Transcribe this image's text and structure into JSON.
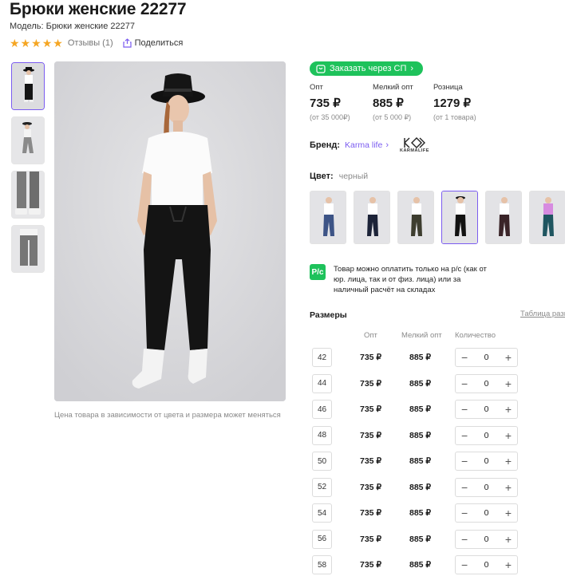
{
  "product": {
    "title": "Брюки женские 22277",
    "model": "Модель: Брюки женские 22277",
    "rating_stars": 5,
    "reviews_label": "Отзывы (1)",
    "share_label": "Поделиться"
  },
  "gallery": {
    "photo_note": "Цена товара в зависимости от цвета и размера может меняться"
  },
  "order": {
    "button_label": "Заказать через СП"
  },
  "prices": [
    {
      "label": "Опт",
      "value": "735 ₽",
      "sub": "(от 35 000₽)"
    },
    {
      "label": "Мелкий опт",
      "value": "885 ₽",
      "sub": "(от 5 000 ₽)"
    },
    {
      "label": "Розница",
      "value": "1279 ₽",
      "sub": "(от 1 товара)"
    }
  ],
  "brand": {
    "label": "Бренд:",
    "name": "Karma life",
    "logo_text": "KARMALIFE"
  },
  "color": {
    "label": "Цвет:",
    "value": "черный",
    "swatches": [
      "blue",
      "navy",
      "olive",
      "black",
      "brown",
      "teal"
    ]
  },
  "payment": {
    "icon_text": "P/c",
    "note": "Товар можно оплатить только на р/с (как от юр. лица, так и от физ. лица) или за наличный расчёт на складах"
  },
  "sizes": {
    "title": "Размеры",
    "table_link": "Таблица разм",
    "headers": {
      "opt": "Опт",
      "small": "Мелкий опт",
      "qty": "Количество"
    },
    "rows": [
      {
        "size": "42",
        "opt": "735 ₽",
        "small": "885 ₽",
        "qty": "0"
      },
      {
        "size": "44",
        "opt": "735 ₽",
        "small": "885 ₽",
        "qty": "0"
      },
      {
        "size": "46",
        "opt": "735 ₽",
        "small": "885 ₽",
        "qty": "0"
      },
      {
        "size": "48",
        "opt": "735 ₽",
        "small": "885 ₽",
        "qty": "0"
      },
      {
        "size": "50",
        "opt": "735 ₽",
        "small": "885 ₽",
        "qty": "0"
      },
      {
        "size": "52",
        "opt": "735 ₽",
        "small": "885 ₽",
        "qty": "0"
      },
      {
        "size": "54",
        "opt": "735 ₽",
        "small": "885 ₽",
        "qty": "0"
      },
      {
        "size": "56",
        "opt": "735 ₽",
        "small": "885 ₽",
        "qty": "0"
      },
      {
        "size": "58",
        "opt": "735 ₽",
        "small": "885 ₽",
        "qty": "0"
      }
    ]
  },
  "colors": {
    "accent": "#7b5cf0",
    "green": "#1ec25b",
    "star": "#f5a623"
  }
}
